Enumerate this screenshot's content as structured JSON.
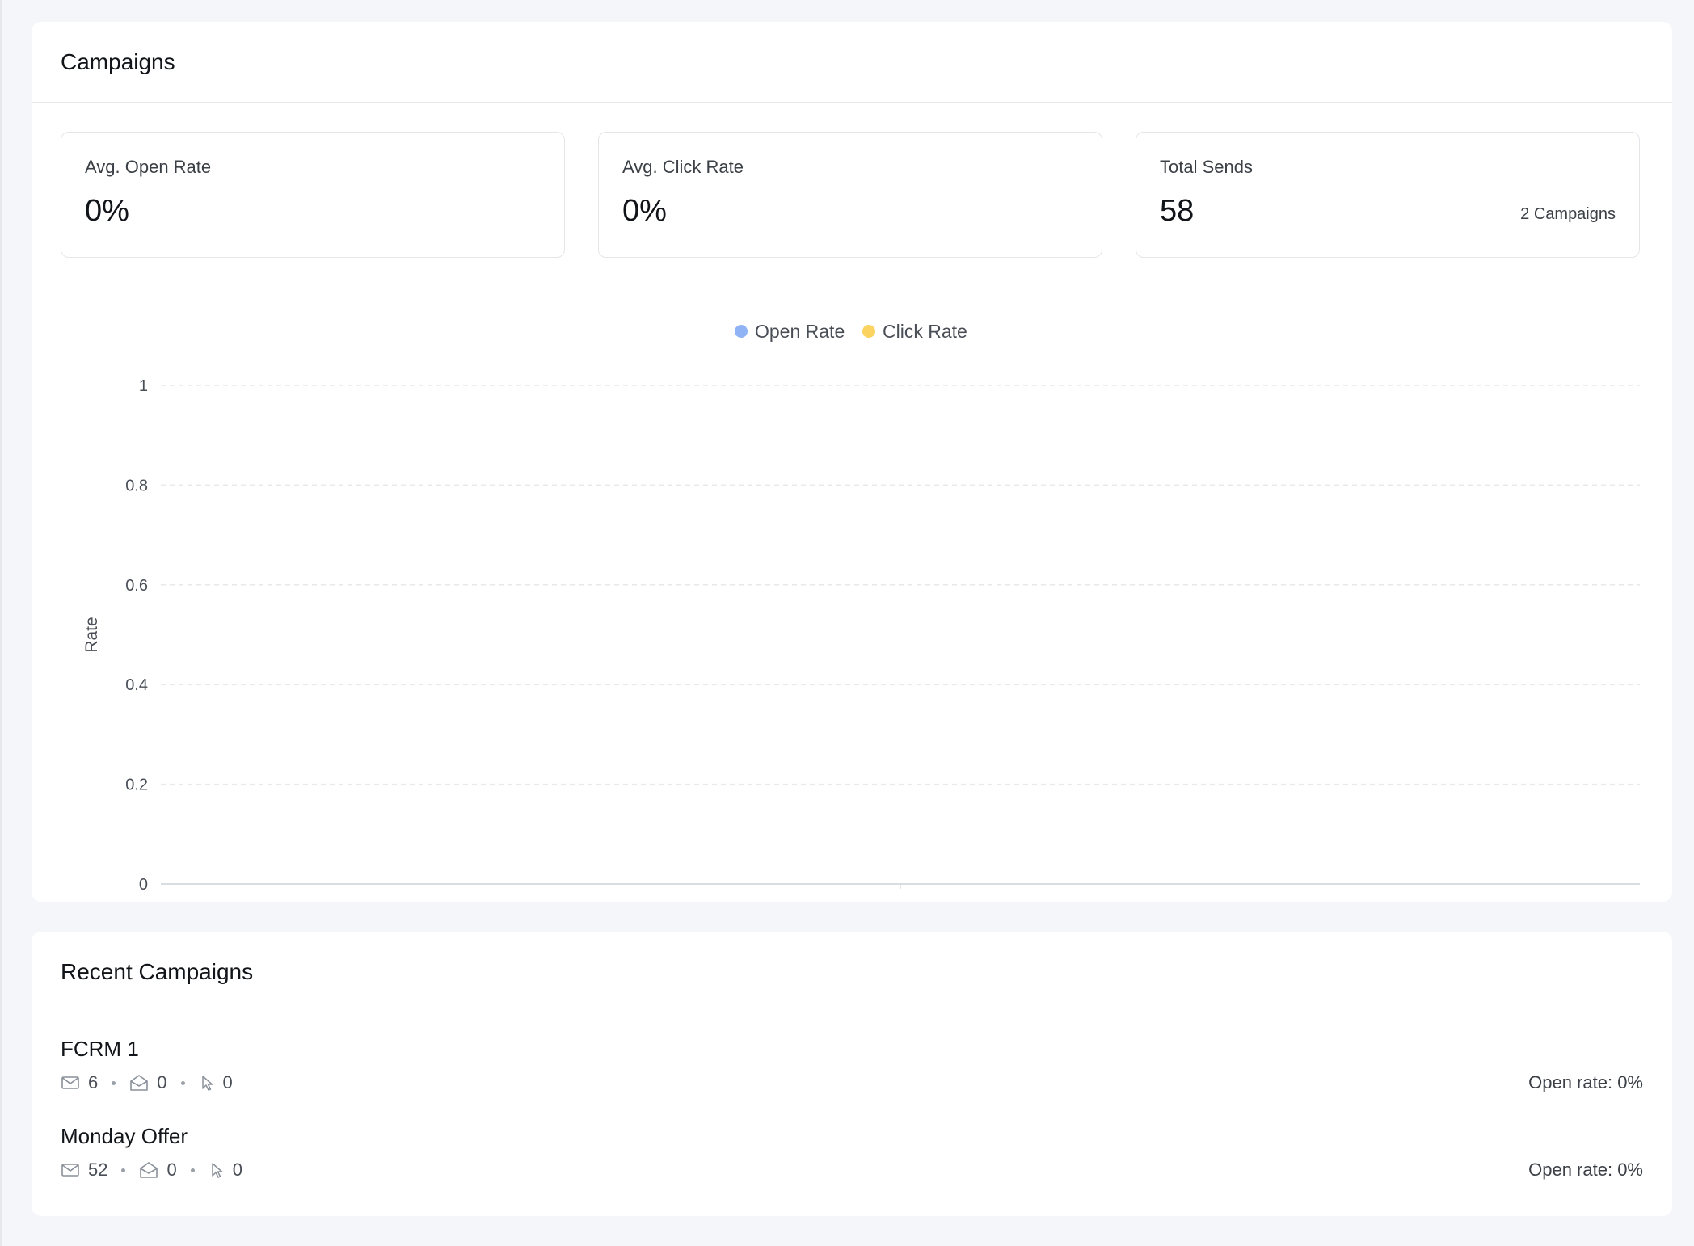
{
  "campaigns_card": {
    "title": "Campaigns",
    "stats": [
      {
        "label": "Avg. Open Rate",
        "value": "0%",
        "meta": ""
      },
      {
        "label": "Avg. Click Rate",
        "value": "0%",
        "meta": ""
      },
      {
        "label": "Total Sends",
        "value": "58",
        "meta": "2 Campaigns"
      }
    ]
  },
  "chart_data": {
    "type": "line",
    "title": "",
    "xlabel": "",
    "ylabel": "Rate",
    "ylim": [
      0,
      1
    ],
    "y_ticks": [
      "0",
      "0.2",
      "0.4",
      "0.6",
      "0.8",
      "1"
    ],
    "legend_position": "top-center",
    "grid": true,
    "series": [
      {
        "name": "Open Rate",
        "color": "#8fb3f5",
        "values": []
      },
      {
        "name": "Click Rate",
        "color": "#fbd360",
        "values": []
      }
    ]
  },
  "recent_card": {
    "title": "Recent Campaigns",
    "items": [
      {
        "name": "FCRM 1",
        "sent": "6",
        "opened": "0",
        "clicked": "0",
        "open_rate": "Open rate: 0%"
      },
      {
        "name": "Monday Offer",
        "sent": "52",
        "opened": "0",
        "clicked": "0",
        "open_rate": "Open rate: 0%"
      }
    ]
  },
  "icons": {
    "sent": "mail-icon",
    "opened": "mail-open-icon",
    "clicked": "cursor-click-icon"
  }
}
